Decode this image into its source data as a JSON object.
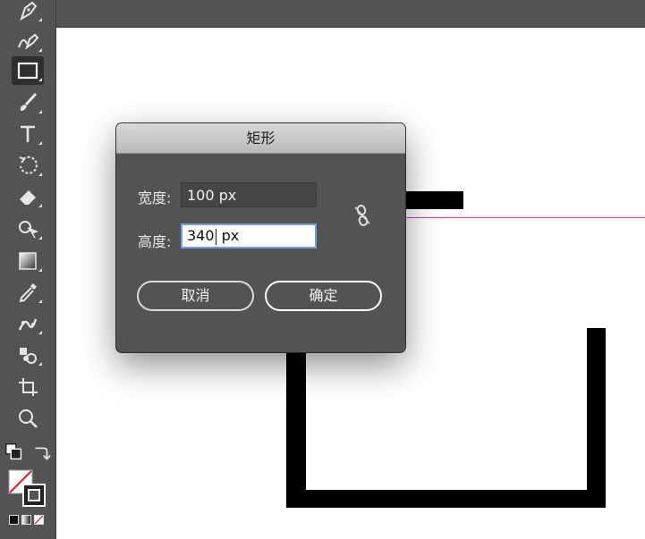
{
  "dialog": {
    "title": "矩形",
    "width_label": "宽度:",
    "width_value": "100 px",
    "height_label": "高度:",
    "height_value_before_caret": "340",
    "height_value_after_caret": " px",
    "cancel_label": "取消",
    "ok_label": "确定"
  },
  "colors": {
    "toolbar_bg": "#535353",
    "dialog_bg": "#535353",
    "guide_magenta": "#c33bcc",
    "focus_ring": "#6f9edc"
  },
  "toolbar": {
    "tools": [
      "pen-icon",
      "curvature-icon",
      "rectangle-icon",
      "paintbrush-icon",
      "type-icon",
      "rotate-icon",
      "eraser-icon",
      "shape-builder-icon",
      "gradient-icon",
      "eyedropper-icon",
      "puppet-warp-icon",
      "symbol-sprayer-icon",
      "artboard-icon",
      "zoom-icon"
    ],
    "active_tool": "rectangle-icon"
  }
}
